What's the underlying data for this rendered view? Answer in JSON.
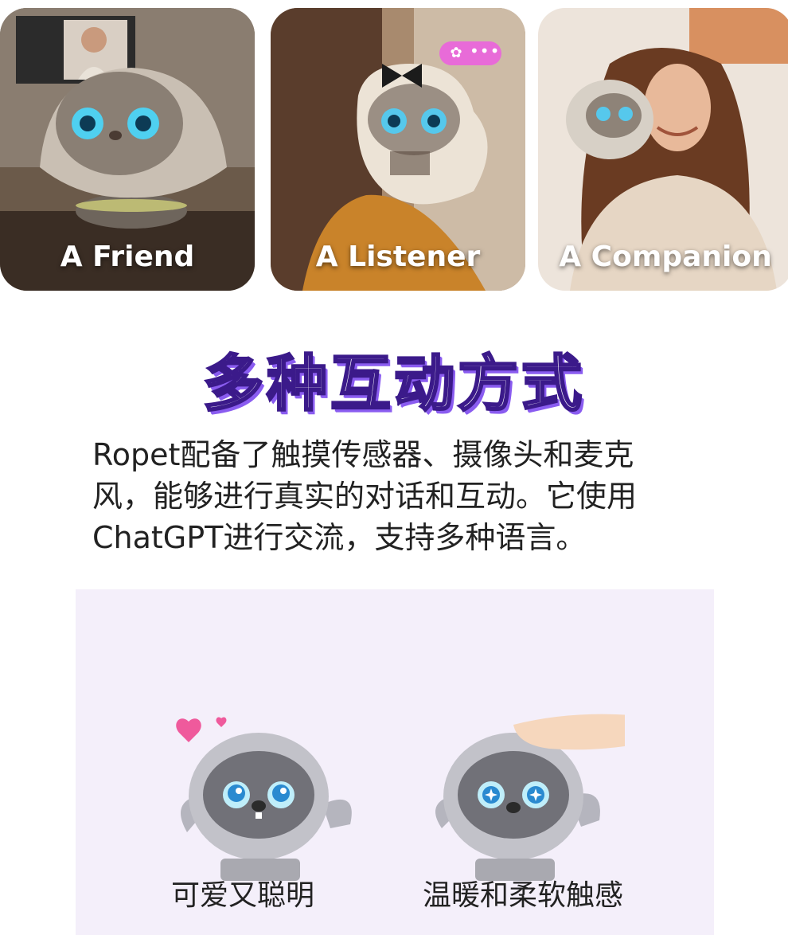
{
  "cards": [
    {
      "label": "A Friend"
    },
    {
      "label": "A Listener"
    },
    {
      "label": "A Companion"
    }
  ],
  "headline": "多种互动方式",
  "description": {
    "line1": "Ropet配备了触摸传感器、摄像头和麦克",
    "line2": "风，能够进行真实的对话和互动。它使用",
    "line3": "ChatGPT进行交流，支持多种语言。"
  },
  "features": [
    {
      "label": "可爱又聪明",
      "icon": "heart-icon"
    },
    {
      "label": "温暖和柔软触感",
      "icon": "hand-icon"
    }
  ],
  "colors": {
    "headline_stroke": "#3b1a8a",
    "headline_shadow": "#8a5cf0",
    "panel_bg": "#f4effa",
    "bubble": "#e86bd8"
  }
}
